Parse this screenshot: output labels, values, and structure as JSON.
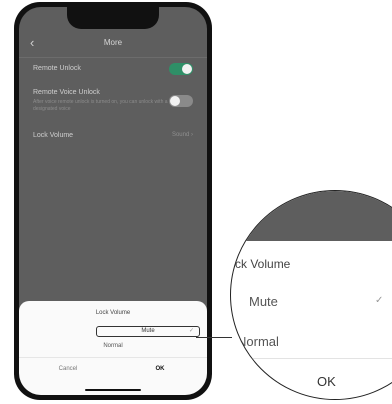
{
  "header": {
    "back_icon": "chevron-left-icon",
    "title": "More"
  },
  "settings": {
    "remote_unlock": {
      "label": "Remote Unlock",
      "enabled": true
    },
    "remote_voice_unlock": {
      "label": "Remote Voice Unlock",
      "description": "After voice remote unlock is turned on, you can unlock with a designated voice",
      "enabled": false
    },
    "lock_volume": {
      "label": "Lock Volume",
      "value": "Sound"
    }
  },
  "sheet": {
    "title": "Lock Volume",
    "options": [
      "Mute",
      "Normal"
    ],
    "selected": "Mute",
    "check_icon": "checkmark-icon",
    "cancel_label": "Cancel",
    "ok_label": "OK"
  },
  "zoom": {
    "label": "ck Volume",
    "mute": "Mute",
    "normal": "Normal",
    "ok": "OK"
  },
  "colors": {
    "toggle_on": "#2f8f67",
    "screen_bg": "#5e5e5e"
  }
}
